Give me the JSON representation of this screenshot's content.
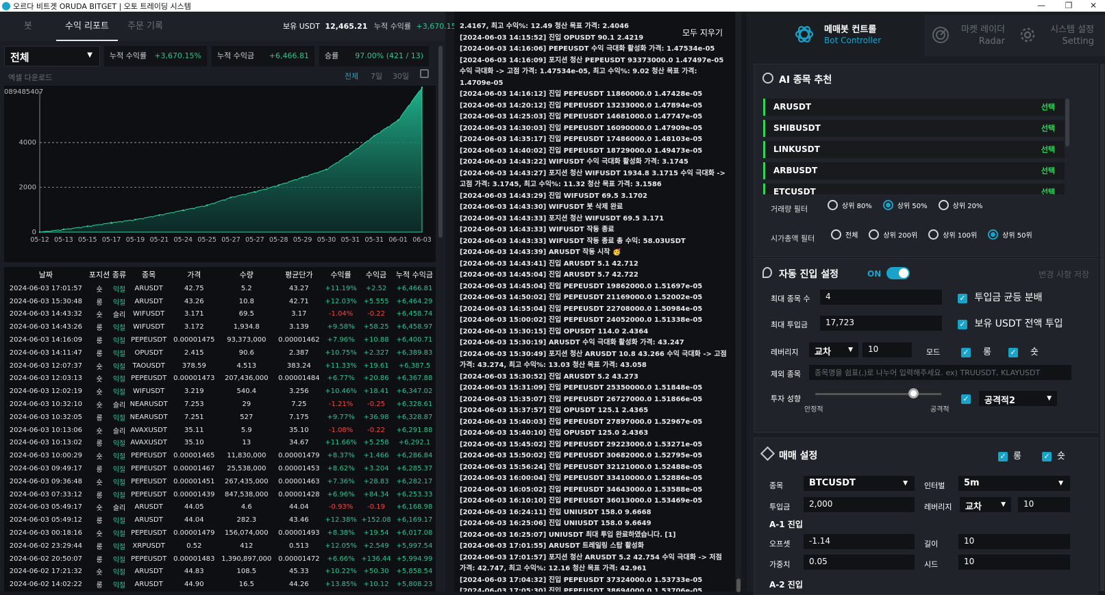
{
  "window": {
    "title": "오르다 비트겟 ORUDA BITGET | 오토 트레이딩 시스템",
    "minimize": "—",
    "maximize": "❐",
    "close": "✕"
  },
  "tabs": [
    "봇",
    "수익 리포트",
    "주문 기록"
  ],
  "summary": {
    "usdt_label": "보유 USDT",
    "usdt_value": "12,465.21",
    "profit_label": "누적 수익률",
    "profit_value": "+3,670.15%"
  },
  "filter": {
    "select": "전체",
    "cum_rate_label": "누적 수익률",
    "cum_rate": "+3,670.15%",
    "cum_amt_label": "누적 수익금",
    "cum_amt": "+6,466.81",
    "win_label": "승률",
    "win": "97.00% (421 / 13)"
  },
  "excel": "엑셀 다운로드",
  "periods": [
    "전체",
    "7일",
    "30일"
  ],
  "chart_data": {
    "type": "area",
    "title": "",
    "xlabel": "",
    "ylabel": "",
    "top_label": "089485407",
    "yticks": [
      0,
      2000,
      4000
    ],
    "ylim": [
      0,
      6300
    ],
    "x": [
      "05-12",
      "05-13",
      "05-15",
      "05-17",
      "05-19",
      "05-21",
      "05-24",
      "05-25",
      "05-27",
      "05-27",
      "05-28",
      "05-29",
      "05-30",
      "05-31",
      "05-31",
      "06-01",
      "06-03"
    ],
    "values": [
      0,
      120,
      260,
      420,
      560,
      760,
      980,
      1200,
      1550,
      1800,
      2100,
      2450,
      2800,
      3500,
      4300,
      5000,
      6466
    ]
  },
  "table": {
    "headers": [
      "날짜",
      "포지션",
      "종류",
      "종목",
      "가격",
      "수량",
      "평균단가",
      "수익률",
      "수익금",
      "누적 수익금"
    ],
    "rows": [
      [
        "2024-06-03 17:01:57",
        "숏",
        "익절",
        "ARUSDT",
        "42.75",
        "5.2",
        "43.27",
        "+11.19%",
        "+2.52",
        "+6,466.81"
      ],
      [
        "2024-06-03 15:30:48",
        "롱",
        "익절",
        "ARUSDT",
        "43.26",
        "10.8",
        "42.71",
        "+12.03%",
        "+5.555",
        "+6,464.29"
      ],
      [
        "2024-06-03 14:43:32",
        "숏",
        "슬리",
        "WIFUSDT",
        "3.171",
        "69.5",
        "3.17",
        "-1.04%",
        "-0.22",
        "+6,458.74"
      ],
      [
        "2024-06-03 14:43:26",
        "롱",
        "익절",
        "WIFUSDT",
        "3.172",
        "1,934.8",
        "3.139",
        "+9.58%",
        "+58.25",
        "+6,458.97"
      ],
      [
        "2024-06-03 14:16:09",
        "롱",
        "익절",
        "PEPEUSDT",
        "0.00001475",
        "93,373,000",
        "0.00001462",
        "+7.96%",
        "+10.88",
        "+6,400.71"
      ],
      [
        "2024-06-03 14:11:47",
        "롱",
        "익절",
        "OPUSDT",
        "2.415",
        "90.6",
        "2.387",
        "+10.75%",
        "+2.327",
        "+6,389.83"
      ],
      [
        "2024-06-03 12:07:37",
        "숏",
        "익절",
        "TAOUSDT",
        "378.59",
        "4.513",
        "383.24",
        "+11.33%",
        "+19.61",
        "+6,387.5"
      ],
      [
        "2024-06-03 12:03:13",
        "숏",
        "익절",
        "PEPEUSDT",
        "0.00001473",
        "207,436,000",
        "0.00001484",
        "+6.77%",
        "+20.86",
        "+6,367.88"
      ],
      [
        "2024-06-03 12:02:19",
        "숏",
        "익절",
        "WIFUSDT",
        "3.219",
        "540.4",
        "3.256",
        "+10.46%",
        "+18.41",
        "+6,347.02"
      ],
      [
        "2024-06-03 10:32:10",
        "숏",
        "슬리",
        "NEARUSDT",
        "7.253",
        "29",
        "7.25",
        "-1.21%",
        "-0.25",
        "+6,328.61"
      ],
      [
        "2024-06-03 10:32:05",
        "롱",
        "익절",
        "NEARUSDT",
        "7.251",
        "527",
        "7.175",
        "+9.77%",
        "+36.98",
        "+6,328.87"
      ],
      [
        "2024-06-03 10:13:06",
        "숏",
        "슬리",
        "AVAXUSDT",
        "35.11",
        "5.9",
        "35.10",
        "-1.08%",
        "-0.22",
        "+6,291.88"
      ],
      [
        "2024-06-03 10:13:02",
        "롱",
        "익절",
        "AVAXUSDT",
        "35.10",
        "13",
        "34.67",
        "+11.66%",
        "+5.258",
        "+6,292.1"
      ],
      [
        "2024-06-03 10:00:29",
        "숏",
        "익절",
        "PEPEUSDT",
        "0.00001465",
        "11,830,000",
        "0.00001479",
        "+8.37%",
        "+1.466",
        "+6,286.84"
      ],
      [
        "2024-06-03 09:49:17",
        "롱",
        "익절",
        "PEPEUSDT",
        "0.00001467",
        "25,538,000",
        "0.00001453",
        "+8.62%",
        "+3.204",
        "+6,285.37"
      ],
      [
        "2024-06-03 09:36:48",
        "숏",
        "익절",
        "PEPEUSDT",
        "0.00001451",
        "267,435,000",
        "0.00001463",
        "+7.36%",
        "+28.83",
        "+6,282.17"
      ],
      [
        "2024-06-03 07:33:12",
        "롱",
        "익절",
        "PEPEUSDT",
        "0.00001439",
        "847,538,000",
        "0.00001428",
        "+6.96%",
        "+84.34",
        "+6,253.33"
      ],
      [
        "2024-06-03 05:49:17",
        "숏",
        "슬리",
        "ARUSDT",
        "44.05",
        "4.6",
        "44.04",
        "-0.93%",
        "-0.19",
        "+6,168.98"
      ],
      [
        "2024-06-03 05:49:12",
        "롱",
        "익절",
        "ARUSDT",
        "44.04",
        "282.3",
        "43.46",
        "+12.38%",
        "+152.08",
        "+6,169.17"
      ],
      [
        "2024-06-03 00:18:16",
        "숏",
        "익절",
        "PEPEUSDT",
        "0.00001479",
        "156,074,000",
        "0.00001493",
        "+8.38%",
        "+19.54",
        "+6,017.08"
      ],
      [
        "2024-06-02 23:29:44",
        "롱",
        "익절",
        "XRPUSDT",
        "0.52",
        "412",
        "0.513",
        "+12.05%",
        "+2.549",
        "+5,997.54"
      ],
      [
        "2024-06-02 20:50:07",
        "롱",
        "익절",
        "PEPEUSDT",
        "0.00001483",
        "1,390,897,000",
        "0.00001472",
        "+6.66%",
        "+136.44",
        "+5,994.99"
      ],
      [
        "2024-06-02 17:21:32",
        "숏",
        "익절",
        "ARUSDT",
        "44.83",
        "108.5",
        "45.33",
        "+10.22%",
        "+50.30",
        "+5,858.54"
      ],
      [
        "2024-06-02 14:02:22",
        "롱",
        "익절",
        "ARUSDT",
        "44.90",
        "16.5",
        "44.26",
        "+13.85%",
        "+10.12",
        "+5,808.23"
      ]
    ]
  },
  "log_clear": "모두 지우기",
  "logs": [
    "2.4167, 최고 수익%: 12.49 청산 목표 가격: 2.4046",
    "[2024-06-03 14:15:52] 진입 OPUSDT 90.1 2.4219",
    "[2024-06-03 14:16:06] PEPEUSDT 수익 극대화 활성화 가격: 1.47534e-05",
    "[2024-06-03 14:16:09] 포지션 청산 PEPEUSDT 93373000.0 1.47497e-05 수익 극대화 -> 고점 가격: 1.47534e-05, 최고 수익%: 9.02 청산 목표 가격: 1.4709e-05",
    "[2024-06-03 14:16:12] 진입 PEPEUSDT 11860000.0 1.47428e-05",
    "[2024-06-03 14:20:12] 진입 PEPEUSDT 13233000.0 1.47894e-05",
    "[2024-06-03 14:25:03] 진입 PEPEUSDT 14681000.0 1.47747e-05",
    "[2024-06-03 14:30:03] 진입 PEPEUSDT 16090000.0 1.47909e-05",
    "[2024-06-03 14:35:17] 진입 PEPEUSDT 17486000.0 1.48103e-05",
    "[2024-06-03 14:40:02] 진입 PEPEUSDT 18729000.0 1.49473e-05",
    "[2024-06-03 14:43:22] WIFUSDT 수익 극대화 활성화 가격: 3.1745",
    "[2024-06-03 14:43:27] 포지션 청산 WIFUSDT 1934.8 3.1715 수익 극대화 -> 고점 가격: 3.1745, 최고 수익%: 11.32 청산 목표 가격: 3.1586",
    "[2024-06-03 14:43:29] 진입 WIFUSDT 69.5 3.1702",
    "[2024-06-03 14:43:30] WIFUSDT 봇 삭제 완료",
    "[2024-06-03 14:43:33] 포지션 청산 WIFUSDT 69.5 3.171",
    "[2024-06-03 14:43:33] WIFUSDT 작동 종료",
    "[2024-06-03 14:43:33] WIFUSDT 작동 종료 총 수익: 58.03USDT",
    "[2024-06-03 14:43:39] ARUSDT 작동 시작 🥳",
    "[2024-06-03 14:43:41] 진입 ARUSDT 5.1 42.712",
    "[2024-06-03 14:45:04] 진입 ARUSDT 5.7 42.722",
    "[2024-06-03 14:45:04] 진입 PEPEUSDT 19862000.0 1.51697e-05",
    "[2024-06-03 14:50:02] 진입 PEPEUSDT 21169000.0 1.52002e-05",
    "[2024-06-03 14:55:04] 진입 PEPEUSDT 22708000.0 1.50984e-05",
    "[2024-06-03 15:00:02] 진입 PEPEUSDT 24052000.0 1.51338e-05",
    "[2024-06-03 15:30:15] 진입 OPUSDT 114.0 2.4364",
    "[2024-06-03 15:30:19] ARUSDT 수익 극대화 활성화 가격: 43.247",
    "[2024-06-03 15:30:49] 포지션 청산 ARUSDT 10.8 43.266 수익 극대화 -> 고점 가격: 43.274, 최고 수익%: 13.03 청산 목표 가격: 43.058",
    "[2024-06-03 15:30:52] 진입 ARUSDT 5.2 43.273",
    "[2024-06-03 15:31:09] 진입 PEPEUSDT 25350000.0 1.51848e-05",
    "[2024-06-03 15:35:07] 진입 PEPEUSDT 26727000.0 1.51866e-05",
    "[2024-06-03 15:37:57] 진입 OPUSDT 125.1 2.4365",
    "[2024-06-03 15:40:03] 진입 PEPEUSDT 27897000.0 1.52967e-05",
    "[2024-06-03 15:40:10] 진입 OPUSDT 125.0 2.4363",
    "[2024-06-03 15:45:02] 진입 PEPEUSDT 29223000.0 1.53271e-05",
    "[2024-06-03 15:50:02] 진입 PEPEUSDT 30682000.0 1.52795e-05",
    "[2024-06-03 15:56:24] 진입 PEPEUSDT 32121000.0 1.52488e-05",
    "[2024-06-03 16:00:04] 진입 PEPEUSDT 33410000.0 1.52886e-05",
    "[2024-06-03 16:05:02] 진입 PEPEUSDT 34643000.0 1.53588e-05",
    "[2024-06-03 16:10:10] 진입 PEPEUSDT 36013000.0 1.53469e-05",
    "[2024-06-03 16:24:11] 진입 UNIUSDT 158.0 9.6668",
    "[2024-06-03 16:25:06] 진입 UNIUSDT 158.0 9.6649",
    "[2024-06-03 16:25:07] UNIUSDT 최대 투입 완료하였습니다. [1]",
    "[2024-06-03 17:01:55] ARUSDT 트레일링 스탑 활성화",
    "[2024-06-03 17:01:57] 포지션 청산 ARUSDT 5.2 42.754 수익 극대화 -> 저점 가격: 42.747, 최고 수익%: 12.16 청산 목표 가격: 42.961",
    "[2024-06-03 17:04:32] 진입 PEPEUSDT 37324000.0 1.53733e-05",
    "[2024-06-03 17:05:30] 진입 PEPEUSDT 38694000.0 1.53706e-05"
  ],
  "nav": [
    {
      "title": "메매봇 컨트롤",
      "sub": "Bot Controller",
      "icon": "openai-icon"
    },
    {
      "title": "마켓 레이더",
      "sub": "Radar",
      "icon": "radar-icon"
    },
    {
      "title": "시스템 설정",
      "sub": "Setting",
      "icon": "gear-icon"
    }
  ],
  "ai": {
    "title": "AI 종목 추천",
    "select_label": "선택",
    "items": [
      "ARUSDT",
      "SHIBUSDT",
      "LINKUSDT",
      "ARBUSDT",
      "ETCUSDT"
    ],
    "volume_label": "거래량 필터",
    "volume_opts": [
      "상위 80%",
      "상위 50%",
      "상위 20%"
    ],
    "volume_selected": 1,
    "cap_label": "시가총액 필터",
    "cap_opts": [
      "전체",
      "상위 200위",
      "상위 100위",
      "상위 50위"
    ],
    "cap_selected": 3
  },
  "auto": {
    "title": "자동 진입 설정",
    "toggle": "ON",
    "save": "변경 사항 저장",
    "max_coins_label": "최대 종목 수",
    "max_coins": "4",
    "equal_label": "투입금 균등 분배",
    "max_invest_label": "최대 투입금",
    "max_invest": "17,723",
    "all_usdt_label": "보유 USDT 전액 투입",
    "lev_label": "레버리지",
    "lev_mode": "교차",
    "lev": "10",
    "mode_label": "모드",
    "long": "롱",
    "short": "숏",
    "exclude_label": "제외 종목",
    "exclude_ph": "종목명을 쉼표(,)로 나누어 입력해주세요. ex) TRUUSDT, KLAYUSDT",
    "style_label": "투자 성향",
    "stable": "안정적",
    "aggressive": "공격적",
    "style_value": "공격적2",
    "style_level": 0.78
  },
  "trade": {
    "title": "매매 설정",
    "long": "롱",
    "short": "숏",
    "symbol_label": "종목",
    "symbol": "BTCUSDT",
    "interval_label": "인터벌",
    "interval": "5m",
    "invest_label": "투입금",
    "invest": "2,000",
    "lev_label": "레버리지",
    "lev_mode": "교차",
    "lev": "10",
    "a1": "A-1 진입",
    "offset_label": "오프셋",
    "offset": "-1.14",
    "length_label": "길이",
    "length": "10",
    "weight_label": "가중치",
    "weight": "0.05",
    "seed_label": "시드",
    "seed": "10",
    "a2": "A-2 진입"
  }
}
